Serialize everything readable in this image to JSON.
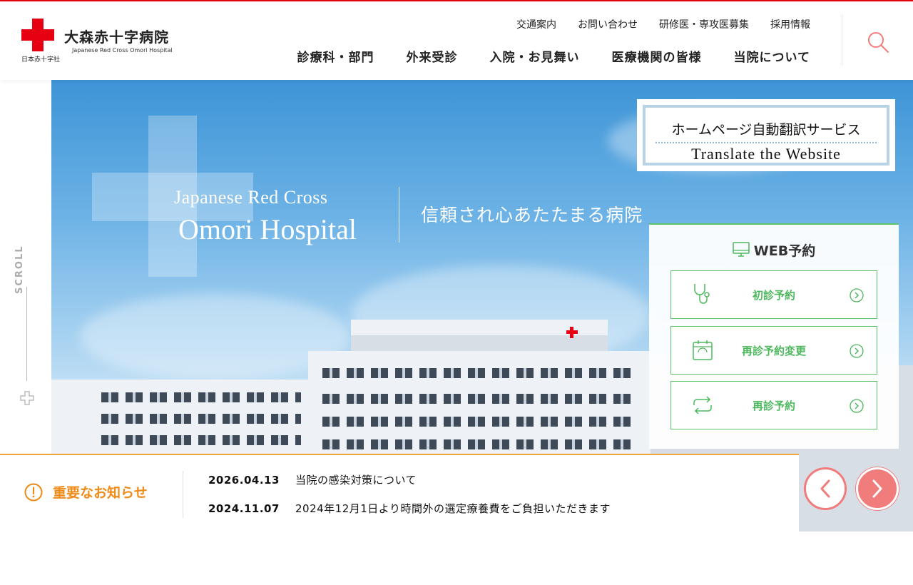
{
  "brand": {
    "name_jp": "大森赤十字病院",
    "name_en": "Japanese Red Cross Omori Hospital",
    "org": "日本赤十字社",
    "accent": "#e60012"
  },
  "util_nav": [
    "交通案内",
    "お問い合わせ",
    "研修医・専攻医募集",
    "採用情報"
  ],
  "main_nav": [
    "診療科・部門",
    "外来受診",
    "入院・お見舞い",
    "医療機関の皆様",
    "当院について"
  ],
  "rail": {
    "scroll_label": "SCROLL"
  },
  "hero": {
    "title_en_line1": "Japanese Red Cross",
    "title_en_line2": "Omori Hospital",
    "tagline": "信頼され心あたたまる病院"
  },
  "translate": {
    "label_jp": "ホームページ自動翻訳サービス",
    "label_en": "Translate the Website"
  },
  "web_reservation": {
    "title": "WEB予約",
    "accent": "#4db85d",
    "buttons": [
      {
        "label": "初診予約",
        "icon": "stethoscope-icon"
      },
      {
        "label": "再診予約変更",
        "icon": "calendar-icon"
      },
      {
        "label": "再診予約",
        "icon": "repeat-icon"
      }
    ]
  },
  "news": {
    "label": "重要なお知らせ",
    "accent": "#ef8a17",
    "items": [
      {
        "date": "2026.04.13",
        "title": "当院の感染対策について"
      },
      {
        "date": "2024.11.07",
        "title": "2024年12月1日より時間外の選定療養費をご負担いただきます"
      }
    ]
  },
  "carousel": {
    "accent": "#f07c7c"
  }
}
